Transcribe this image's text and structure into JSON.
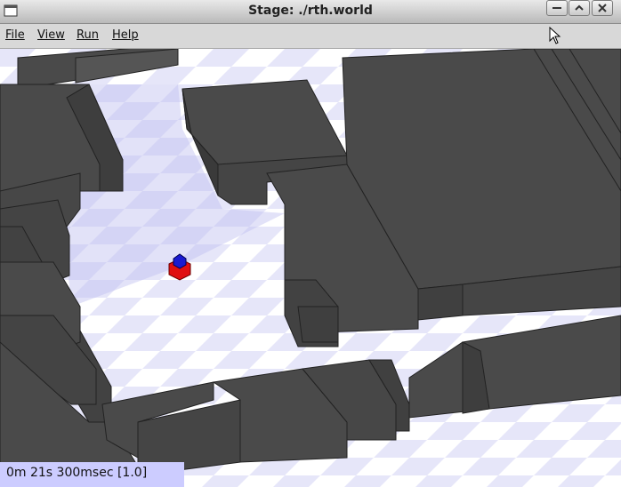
{
  "window": {
    "title": "Stage: ./rth.world"
  },
  "menu": {
    "file": "File",
    "view": "View",
    "run": "Run",
    "help": "Help"
  },
  "status": {
    "time": "0m 21s 300msec [1.0]"
  },
  "icons": {
    "app": "app-icon",
    "minimize": "minimize-icon",
    "maximize": "maximize-icon",
    "close": "close-icon",
    "cursor": "mouse-cursor-icon"
  },
  "colors": {
    "wall": "#4a4a4a",
    "floor_dark": "#e4e4f8",
    "floor_light": "#ffffff",
    "robot_body": "#e01010",
    "robot_top": "#1a1ad0",
    "status_bg": "#ccccff"
  }
}
